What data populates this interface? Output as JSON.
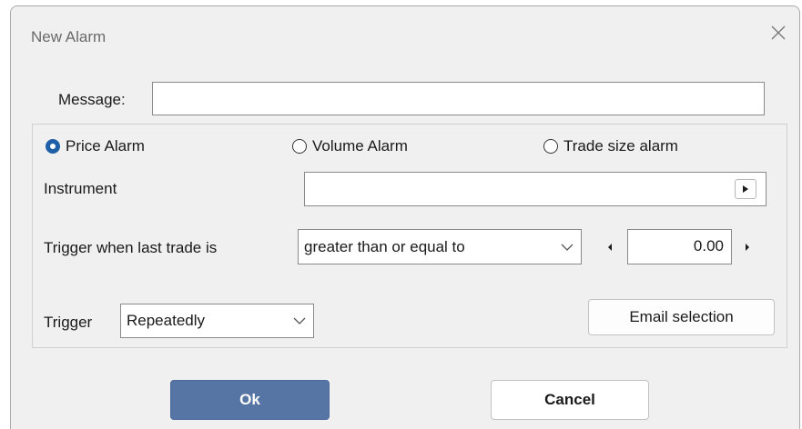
{
  "window": {
    "title": "New Alarm"
  },
  "message": {
    "label": "Message:",
    "value": ""
  },
  "alarm_type": {
    "options": [
      {
        "label": "Price Alarm",
        "selected": true
      },
      {
        "label": "Volume Alarm",
        "selected": false
      },
      {
        "label": "Trade size alarm",
        "selected": false
      }
    ]
  },
  "instrument": {
    "label": "Instrument",
    "value": ""
  },
  "trigger_condition": {
    "label": "Trigger when last trade is",
    "selected": "greater than or equal to",
    "value": "0.00"
  },
  "trigger": {
    "label": "Trigger",
    "selected": "Repeatedly"
  },
  "buttons": {
    "email_selection": "Email selection",
    "ok": "Ok",
    "cancel": "Cancel"
  },
  "colors": {
    "ok_button": "#5674a4",
    "radio_selected": "#1f5fa8",
    "dialog_background": "#f0f0f0"
  },
  "icons": {
    "close": "close-icon",
    "combo_arrow": "chevron-down-icon",
    "instrument_picker": "play-arrow-icon",
    "spin_left": "decrement-arrow-icon",
    "spin_right": "increment-arrow-icon"
  }
}
